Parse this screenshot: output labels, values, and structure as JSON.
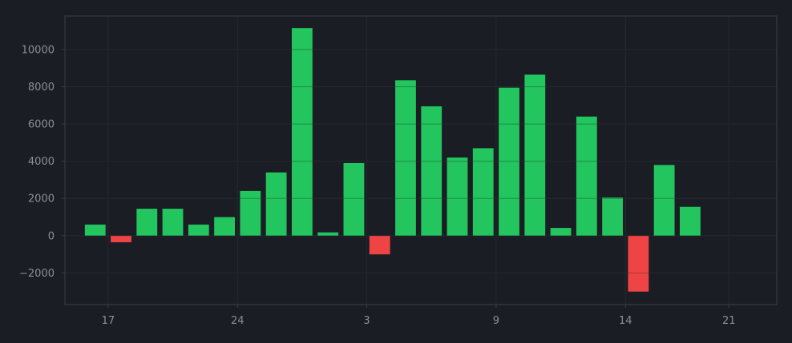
{
  "chart_data": {
    "type": "bar",
    "values": [
      600,
      -350,
      1450,
      1450,
      600,
      1000,
      2400,
      3400,
      11150,
      180,
      3900,
      -1000,
      8350,
      6950,
      4200,
      4700,
      7950,
      8650,
      420,
      6400,
      2050,
      -3000,
      3800,
      1550
    ],
    "x_tick_labels": [
      "17",
      "24",
      "3",
      "9",
      "14",
      "21"
    ],
    "x_tick_positions": [
      0.5,
      5.5,
      10.5,
      15.5,
      20.5,
      24.5
    ],
    "xlim": [
      -1.17,
      26.35
    ],
    "y_ticks": [
      -2000,
      0,
      2000,
      4000,
      6000,
      8000,
      10000
    ],
    "y_tick_labels": [
      "−2000",
      "0",
      "2000",
      "4000",
      "6000",
      "8000",
      "10000"
    ],
    "ylim": [
      -3700,
      11800
    ],
    "grid": true,
    "colors": {
      "positive": "#22c55e",
      "negative": "#ef4444",
      "background": "#1a1d24",
      "plot_border": "#3a3e47",
      "grid": "#2a2e36",
      "tick_text": "#8a8f99"
    }
  }
}
